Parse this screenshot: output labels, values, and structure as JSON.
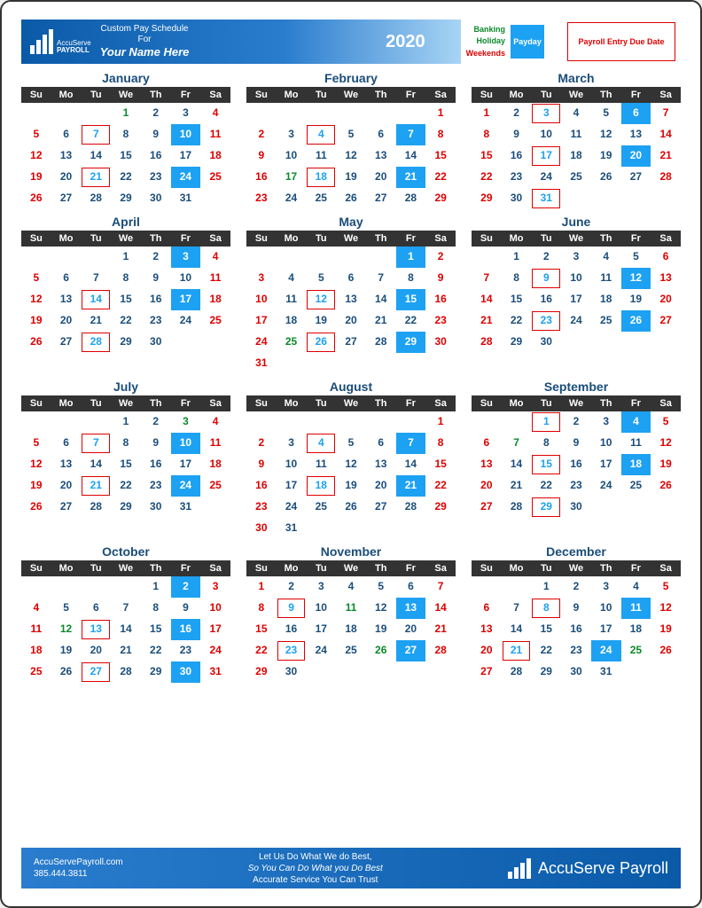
{
  "header": {
    "title_l1": "Custom Pay Schedule",
    "title_l2": "For",
    "name": "Your Name Here",
    "year": "2020",
    "logo_top": "AccuServe",
    "logo_bot": "PAYROLL"
  },
  "legend": {
    "bank": "Banking\nHoliday",
    "weekends": "Weekends",
    "payday": "Payday",
    "due": "Payroll Entry Due Date"
  },
  "days": [
    "Su",
    "Mo",
    "Tu",
    "We",
    "Th",
    "Fr",
    "Sa"
  ],
  "months": [
    {
      "name": "January",
      "start": 3,
      "len": 31,
      "hol": [
        1
      ],
      "pay": [
        10,
        24
      ],
      "due": [
        7,
        21
      ]
    },
    {
      "name": "February",
      "start": 6,
      "len": 29,
      "hol": [
        17
      ],
      "pay": [
        7,
        21
      ],
      "due": [
        4,
        18
      ]
    },
    {
      "name": "March",
      "start": 0,
      "len": 31,
      "hol": [],
      "pay": [
        6,
        20
      ],
      "due": [
        3,
        17,
        31
      ]
    },
    {
      "name": "April",
      "start": 3,
      "len": 30,
      "hol": [],
      "pay": [
        3,
        17
      ],
      "due": [
        14,
        28
      ]
    },
    {
      "name": "May",
      "start": 5,
      "len": 31,
      "hol": [
        25
      ],
      "pay": [
        1,
        15,
        29
      ],
      "due": [
        12,
        26
      ]
    },
    {
      "name": "June",
      "start": 1,
      "len": 30,
      "hol": [],
      "pay": [
        12,
        26
      ],
      "due": [
        9,
        23
      ]
    },
    {
      "name": "July",
      "start": 3,
      "len": 31,
      "hol": [
        3
      ],
      "pay": [
        10,
        24
      ],
      "due": [
        7,
        21
      ]
    },
    {
      "name": "August",
      "start": 6,
      "len": 31,
      "hol": [],
      "pay": [
        7,
        21
      ],
      "due": [
        4,
        18
      ]
    },
    {
      "name": "September",
      "start": 2,
      "len": 30,
      "hol": [
        7
      ],
      "pay": [
        4,
        18
      ],
      "due": [
        1,
        15,
        29
      ]
    },
    {
      "name": "October",
      "start": 4,
      "len": 31,
      "hol": [
        12
      ],
      "pay": [
        2,
        16,
        30
      ],
      "due": [
        13,
        27
      ]
    },
    {
      "name": "November",
      "start": 0,
      "len": 30,
      "hol": [
        11,
        26
      ],
      "pay": [
        13,
        27
      ],
      "due": [
        9,
        23
      ]
    },
    {
      "name": "December",
      "start": 2,
      "len": 31,
      "hol": [
        25
      ],
      "pay": [
        11,
        24
      ],
      "due": [
        8,
        21
      ]
    }
  ],
  "footer": {
    "web": "AccuServePayroll.com",
    "phone": "385.444.3811",
    "l1": "Let Us Do What We do Best,",
    "l2": "So You Can Do What you Do Best",
    "l3": "Accurate Service You Can Trust",
    "brand": "AccuServe Payroll"
  }
}
